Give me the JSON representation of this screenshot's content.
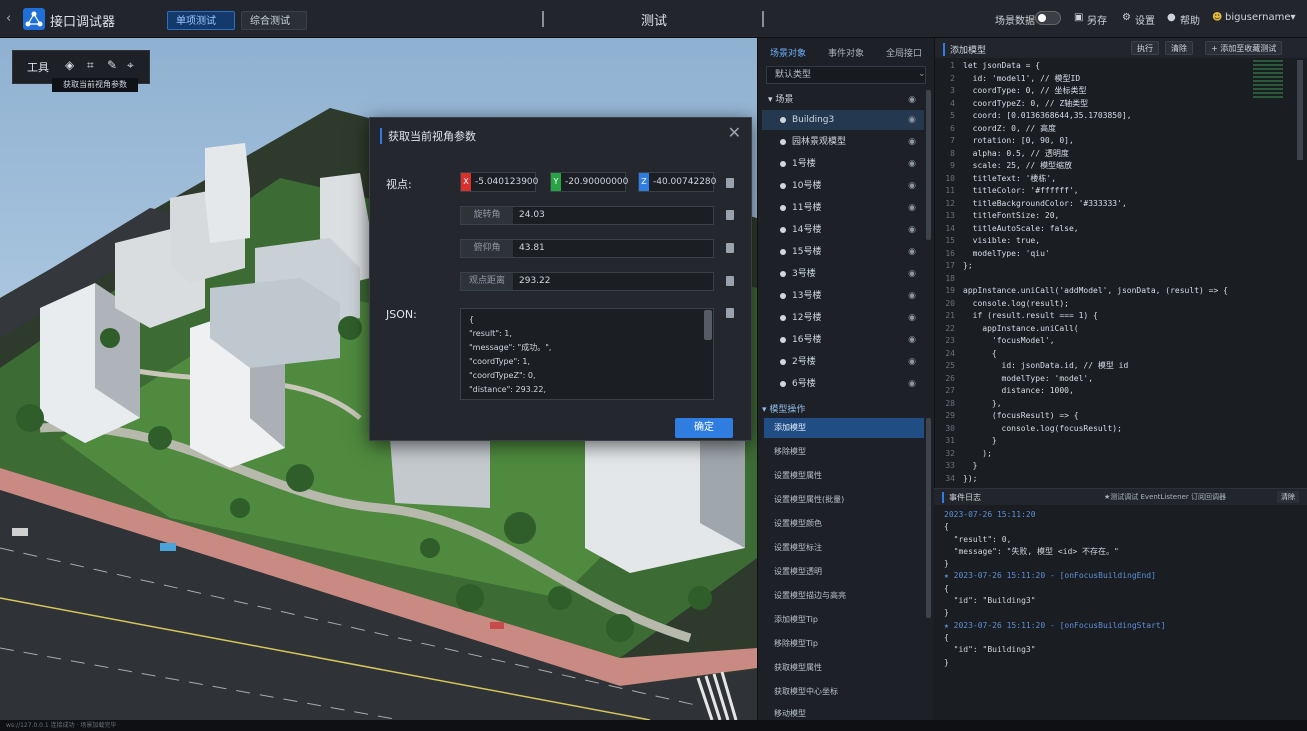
{
  "app": {
    "title": "接口调试器",
    "back_icon": "arrow-left-icon",
    "logo_icon": "network-logo-icon"
  },
  "toolbar": {
    "single_test": "单项测试",
    "multi_test": "综合测试",
    "tab_label": "测试",
    "scene_label": "场景数据",
    "save_label": "另存",
    "settings_label": "设置",
    "help_label": "帮助",
    "user_label": "bigusername▾"
  },
  "viewport": {
    "tools_label": "工具",
    "tool_tip": "获取当前视角参数"
  },
  "dialog": {
    "title": "获取当前视角参数",
    "viewpoint_label": "视点:",
    "coords": [
      {
        "tag": "X",
        "value": "-5.040123900",
        "color": "#d9302b"
      },
      {
        "tag": "Y",
        "value": "-20.90000000",
        "color": "#27a245"
      },
      {
        "tag": "Z",
        "value": "-40.00742280",
        "color": "#2f7de1"
      }
    ],
    "fields": [
      {
        "key": "旋转角",
        "value": "24.03"
      },
      {
        "key": "俯仰角",
        "value": "43.81"
      },
      {
        "key": "观点距离",
        "value": "293.22"
      }
    ],
    "json_label": "JSON:",
    "json_lines": [
      "{",
      "  \"result\": 1,",
      "  \"message\": \"成功。\",",
      "  \"coordType\": 1,",
      "  \"coordTypeZ\": 0,",
      "  \"distance\": 293.22,"
    ],
    "ok_label": "确定"
  },
  "midpanel": {
    "tabs": [
      "场景对象",
      "事件对象",
      "全局接口"
    ],
    "select_value": "默认类型",
    "group_label": "▾ 场景",
    "rows": [
      "Building3",
      "园林景观模型",
      "1号楼",
      "10号楼",
      "11号楼",
      "14号楼",
      "15号楼",
      "3号楼",
      "13号楼",
      "12号楼",
      "16号楼",
      "2号楼",
      "6号楼"
    ],
    "section_label": "▾ 模型操作",
    "items": [
      "添加模型",
      "移除模型",
      "设置模型属性",
      "设置模型属性(批量)",
      "设置模型颜色",
      "设置模型标注",
      "设置模型透明",
      "设置模型描边与高亮",
      "添加模型Tip",
      "移除模型Tip",
      "获取模型属性",
      "获取模型中心坐标",
      "移动模型"
    ]
  },
  "codepanel": {
    "title": "添加模型",
    "buttons": [
      "执行",
      "清除",
      "+ 添加至收藏测试"
    ],
    "line_numbers": [
      "1",
      "2",
      "3",
      "4",
      "5",
      "6",
      "7",
      "8",
      "9",
      "10",
      "11",
      "12",
      "13",
      "14",
      "15",
      "16",
      "17",
      "18",
      "19",
      "20",
      "21",
      "22",
      "23",
      "24",
      "25",
      "26",
      "27",
      "28",
      "29",
      "30",
      "31",
      "32",
      "33",
      "34"
    ],
    "code_lines": [
      "let jsonData = {",
      "  id: 'model1', // 模型ID",
      "  coordType: 0, // 坐标类型",
      "  coordTypeZ: 0, // Z轴类型",
      "  coord: [0.0136368644,35.1703850],",
      "  coordZ: 0, // 高度",
      "  rotation: [0, 90, 0],",
      "  alpha: 0.5, // 透明度",
      "  scale: 25, // 模型缩放",
      "  titleText: '楼栋',",
      "  titleColor: '#ffffff',",
      "  titleBackgroundColor: '#333333',",
      "  titleFontSize: 20,",
      "  titleAutoScale: false,",
      "  visible: true,",
      "  modelType: 'qiu'",
      "};",
      "",
      "appInstance.uniCall('addModel', jsonData, (result) => {",
      "  console.log(result);",
      "  if (result.result === 1) {",
      "    appInstance.uniCall(",
      "      'focusModel',",
      "      {",
      "        id: jsonData.id, // 模型 id",
      "        modelType: 'model',",
      "        distance: 1000,",
      "      },",
      "      (focusResult) => {",
      "        console.log(focusResult);",
      "      }",
      "    );",
      "  }",
      "});"
    ]
  },
  "console": {
    "title": "事件日志",
    "options": "★测试调试 EventListener 订阅回调器",
    "clear_label": "清除",
    "lines": [
      {
        "kind": "ts",
        "text": "2023-07-26 15:11:20"
      },
      {
        "kind": "plain",
        "text": "{"
      },
      {
        "kind": "plain",
        "text": "  \"result\": 0,"
      },
      {
        "kind": "plain",
        "text": "  \"message\": \"失败, 模型 &lt;id&gt; 不存在。\""
      },
      {
        "kind": "plain",
        "text": "}"
      },
      {
        "kind": "ts",
        "text": "★ 2023-07-26 15:11:20 - [onFocusBuildingEnd]"
      },
      {
        "kind": "plain",
        "text": "{"
      },
      {
        "kind": "plain",
        "text": "  \"id\": \"Building3\""
      },
      {
        "kind": "plain",
        "text": "}"
      },
      {
        "kind": "ts",
        "text": "★ 2023-07-26 15:11:20 - [onFocusBuildingStart]"
      },
      {
        "kind": "plain",
        "text": "{"
      },
      {
        "kind": "plain",
        "text": "  \"id\": \"Building3\""
      },
      {
        "kind": "plain",
        "text": "}"
      }
    ]
  },
  "statusbar": {
    "left": "ws://127.0.0.1 连接成功 · 场景加载完毕"
  }
}
